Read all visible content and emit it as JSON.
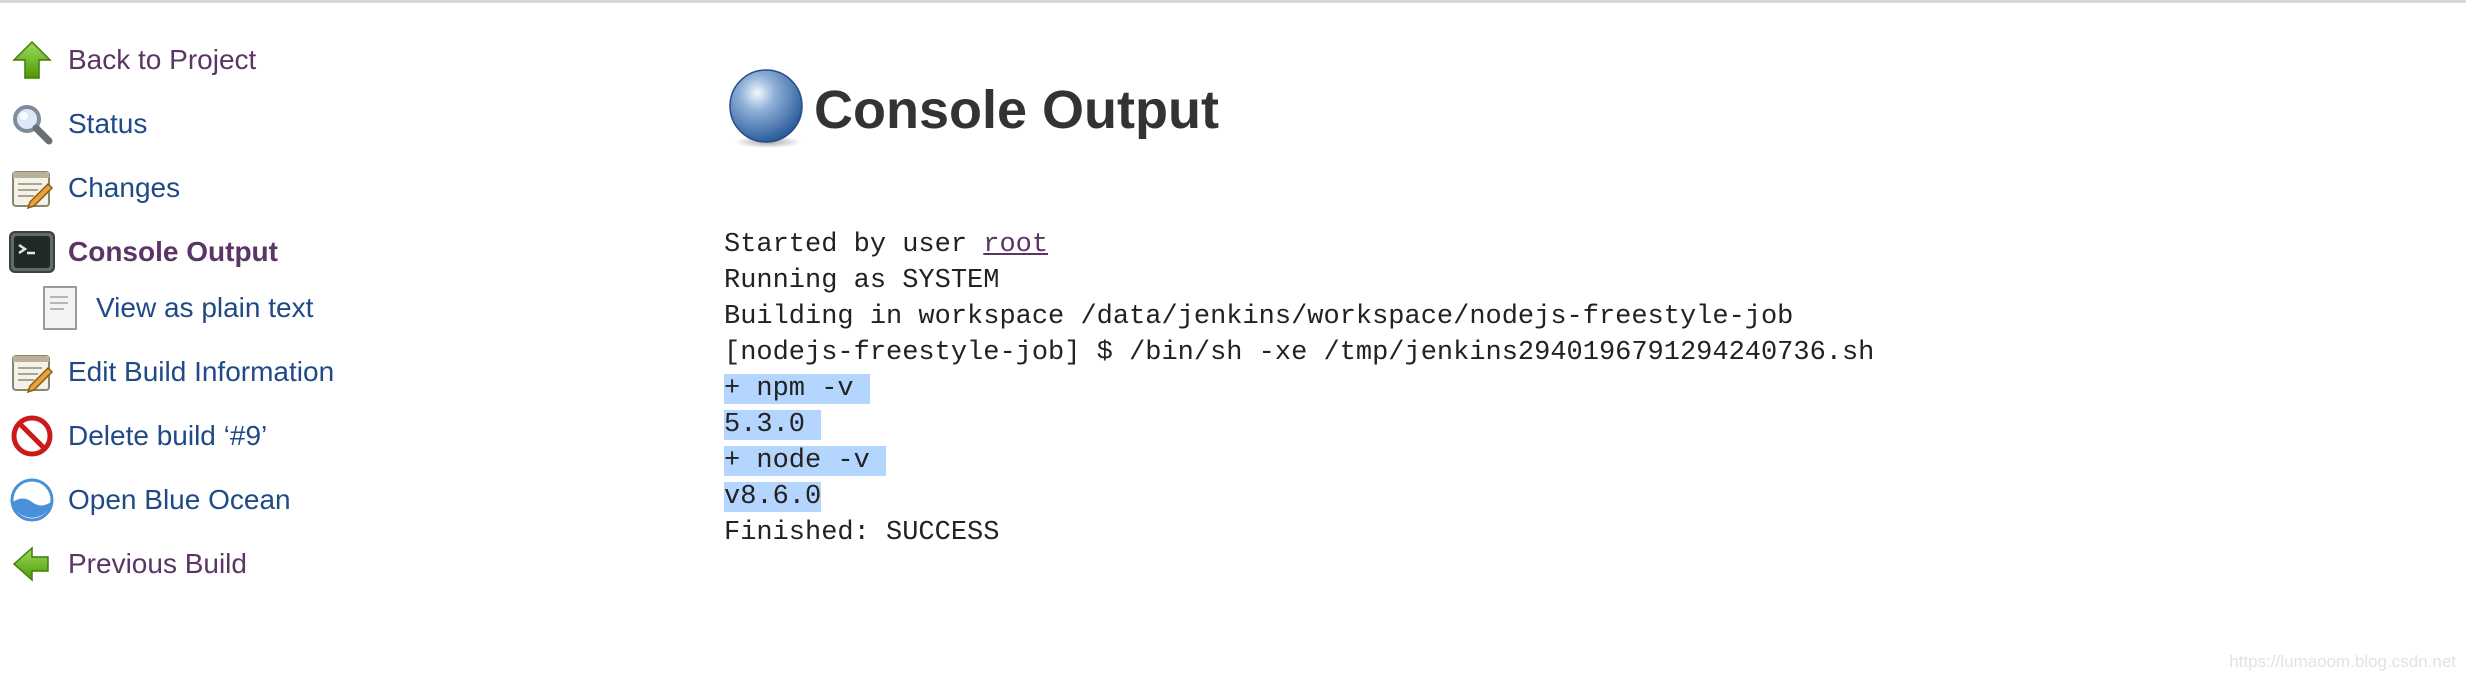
{
  "sidebar": {
    "items": [
      {
        "label": "Back to Project",
        "icon": "arrow-up-icon"
      },
      {
        "label": "Status",
        "icon": "search-icon"
      },
      {
        "label": "Changes",
        "icon": "notepad-icon"
      },
      {
        "label": "Console Output",
        "icon": "terminal-icon"
      },
      {
        "label": "View as plain text",
        "icon": "document-icon"
      },
      {
        "label": "Edit Build Information",
        "icon": "notepad-icon"
      },
      {
        "label": "Delete build ‘#9’",
        "icon": "no-entry-icon"
      },
      {
        "label": "Open Blue Ocean",
        "icon": "blue-ocean-icon"
      },
      {
        "label": "Previous Build",
        "icon": "arrow-left-icon"
      }
    ]
  },
  "main": {
    "title": "Console Output",
    "title_icon": "blue-ball-icon"
  },
  "console": {
    "started_prefix": "Started by user ",
    "started_user": "root",
    "lines": [
      "Running as SYSTEM",
      "Building in workspace /data/jenkins/workspace/nodejs-freestyle-job",
      "[nodejs-freestyle-job] $ /bin/sh -xe /tmp/jenkins2940196791294240736.sh"
    ],
    "selected_lines": [
      "+ npm -v ",
      "5.3.0 ",
      "+ node -v ",
      "v8.6.0"
    ],
    "final_line": "Finished: SUCCESS"
  },
  "watermark": "https://lumaoom.blog.csdn.net",
  "colors": {
    "link": "#204a87",
    "visited": "#5c3566",
    "selection": "#b4d5fe"
  }
}
